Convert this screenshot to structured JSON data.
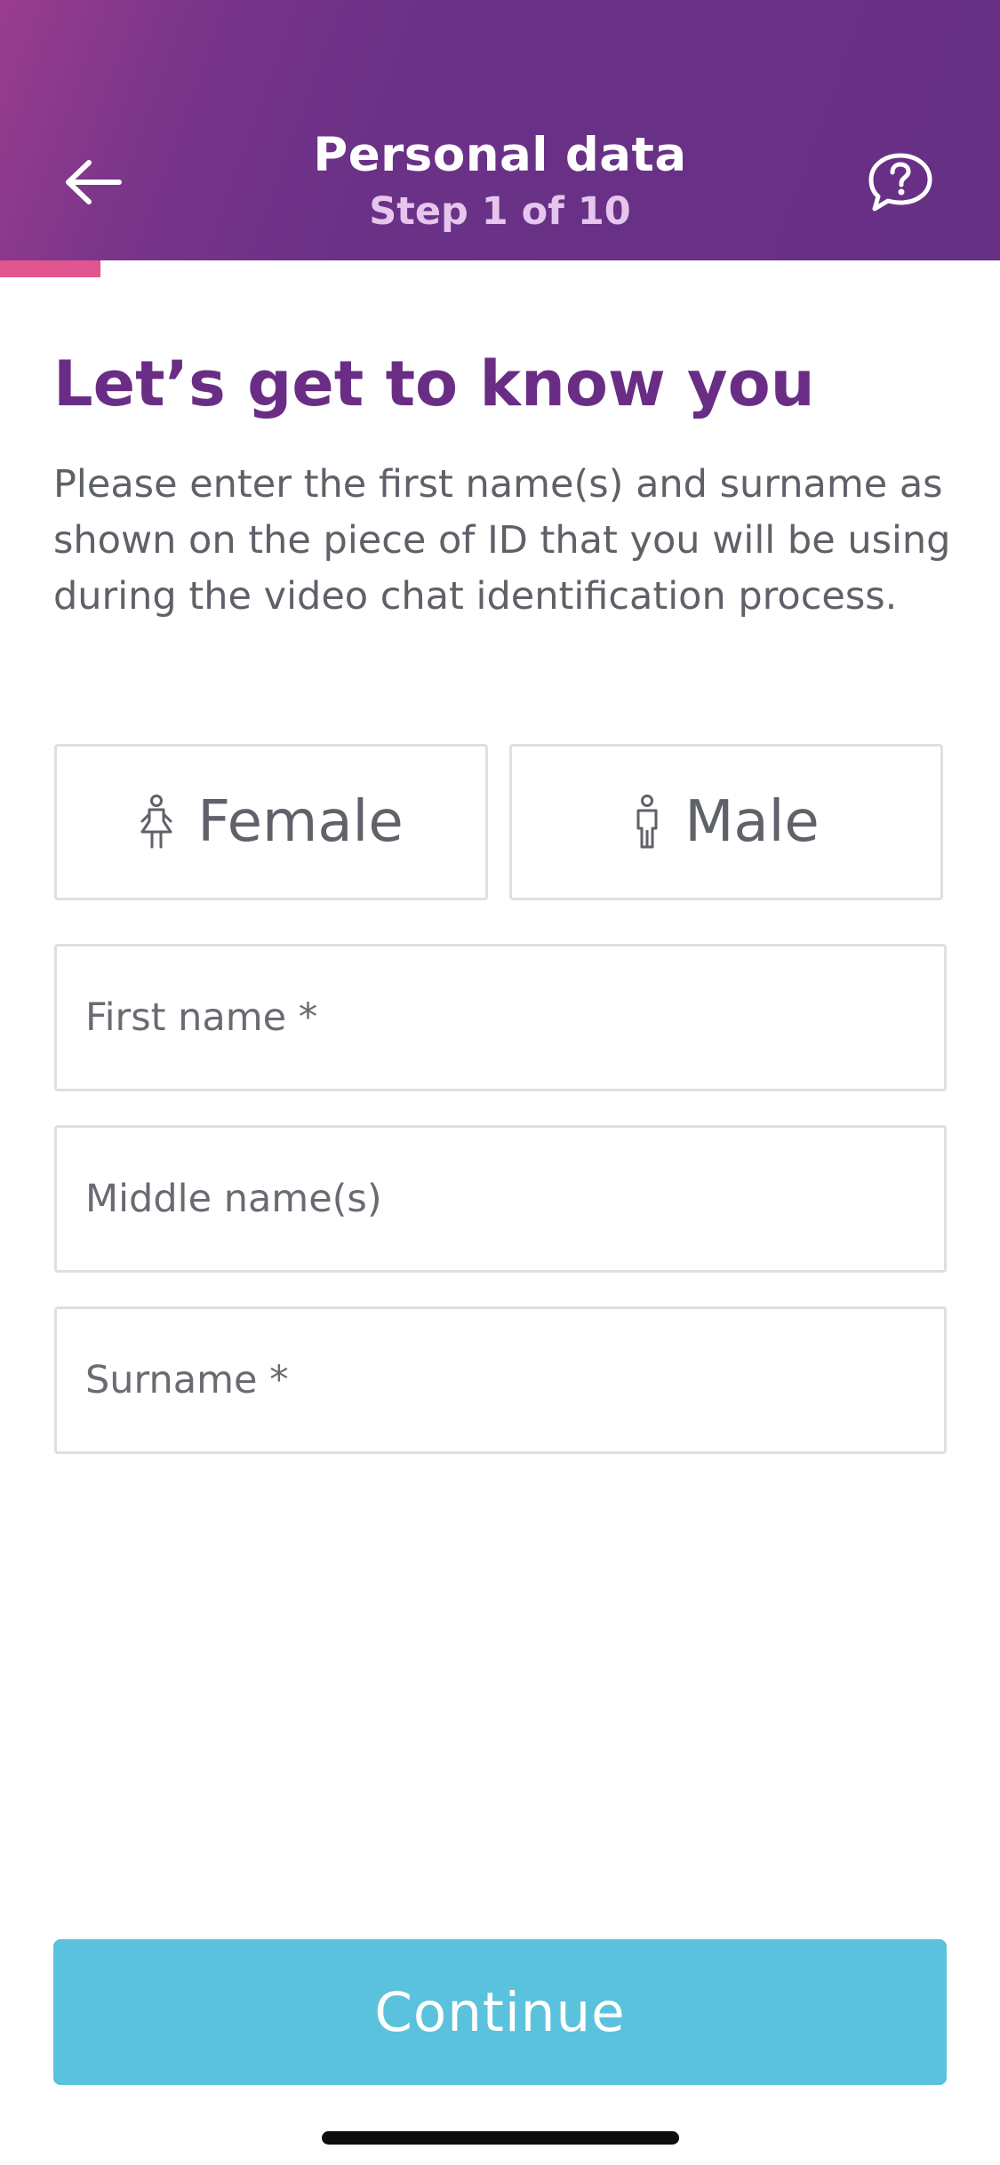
{
  "header": {
    "title": "Personal data",
    "step": "Step 1 of 10",
    "back_icon": "arrow-left-icon",
    "help_icon": "help-chat-bubble-icon",
    "gradient_colors": [
      "#9a3d8f",
      "#663085"
    ]
  },
  "progress": {
    "current_step": 1,
    "total_steps": 10,
    "fraction": 0.1,
    "color": "#e0548f"
  },
  "main": {
    "headline": "Let’s get to know you",
    "intro": "Please enter the first name(s) and surname as shown on the piece of ID that you will be using during the video chat identification process.",
    "headline_color": "#6a2d85"
  },
  "gender": {
    "options": [
      {
        "label": "Female",
        "icon": "female-figure-icon"
      },
      {
        "label": "Male",
        "icon": "male-figure-icon"
      }
    ]
  },
  "form": {
    "first_name": {
      "placeholder": "First name *",
      "value": ""
    },
    "middle_name": {
      "placeholder": "Middle name(s)",
      "value": ""
    },
    "surname": {
      "placeholder": "Surname *",
      "value": ""
    }
  },
  "footer": {
    "continue_label": "Continue",
    "continue_color": "#5bc2dd"
  }
}
